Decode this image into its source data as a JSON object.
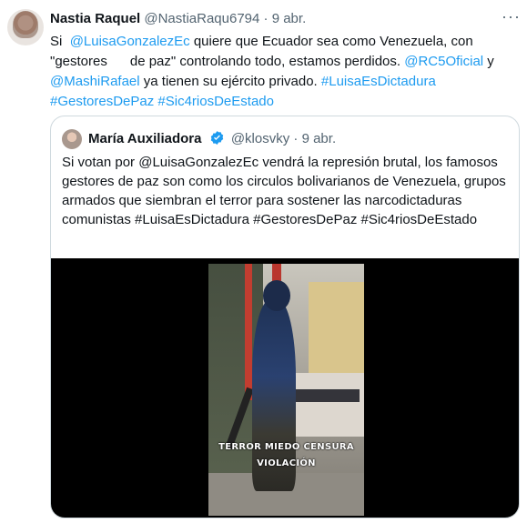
{
  "tweet": {
    "name": "Nastia Raquel",
    "handle": "@NastiaRaqu6794",
    "separator": "·",
    "date": "9 abr.",
    "more_label": "···",
    "text_parts": [
      {
        "t": "Si  ",
        "link": false
      },
      {
        "t": "@LuisaGonzalezEc",
        "link": true
      },
      {
        "t": " quiere que Ecuador sea como Venezuela, con \"gestores      de paz\" controlando todo, estamos perdidos. ",
        "link": false
      },
      {
        "t": "@RC5Oficial",
        "link": true
      },
      {
        "t": " y ",
        "link": false
      },
      {
        "t": "@MashiRafael",
        "link": true
      },
      {
        "t": " ya tienen su ejército privado. ",
        "link": false
      },
      {
        "t": "#LuisaEsDictadura",
        "link": true
      },
      {
        "t": " ",
        "link": false
      },
      {
        "t": "#GestoresDePaz",
        "link": true
      },
      {
        "t": " ",
        "link": false
      },
      {
        "t": "#Sic4riosDeEstado",
        "link": true
      }
    ]
  },
  "quote": {
    "name": "María Auxiliadora",
    "handle": "@klosvky",
    "separator": "·",
    "date": "9 abr.",
    "text": "Si votan por @LuisaGonzalezEc vendrá la represión brutal, los famosos gestores de paz son como los circulos bolivarianos de Venezuela, grupos armados que siembran el terror para sostener las narcodictaduras comunistas #LuisaEsDictadura #GestoresDePaz #Sic4riosDeEstado",
    "video": {
      "caption_line1": "TERROR MIEDO CENSURA",
      "caption_line2": "VIOLACIÓN"
    }
  },
  "colors": {
    "link": "#1d9bf0",
    "muted": "#536471",
    "border": "#cfd9de",
    "verified": "#1d9bf0"
  },
  "icons": [
    "more-icon",
    "verified-badge-icon"
  ]
}
